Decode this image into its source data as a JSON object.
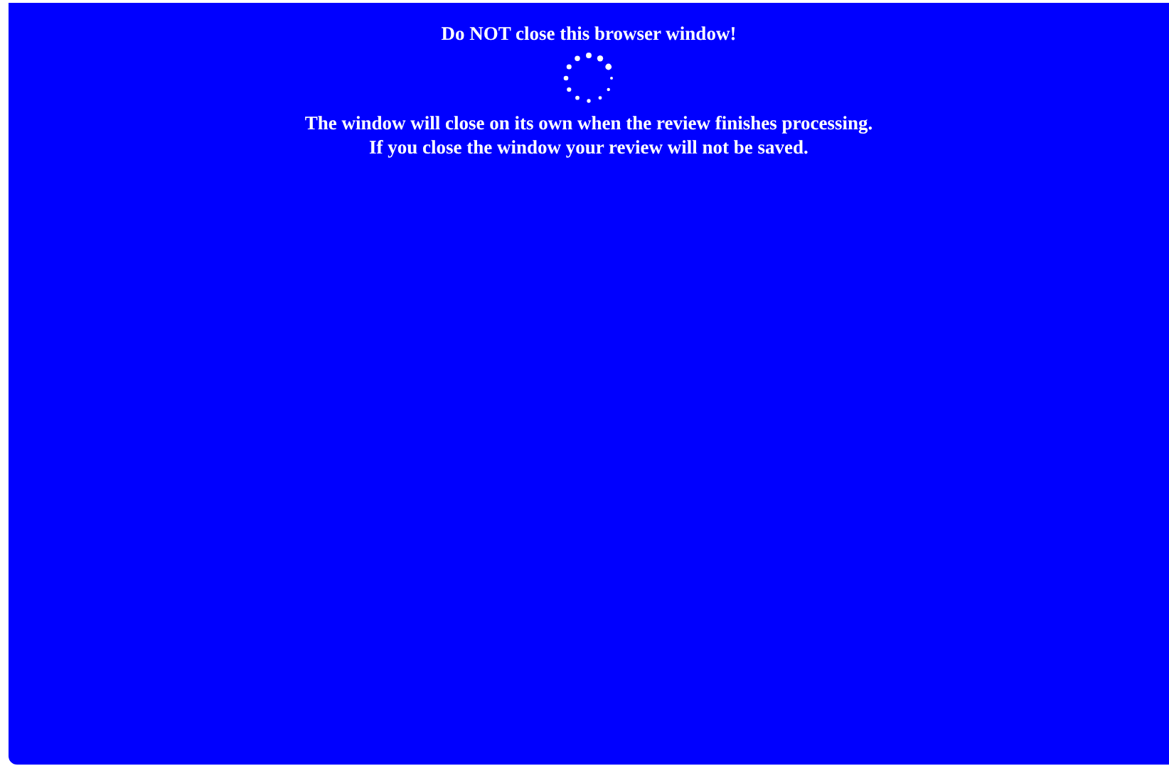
{
  "heading": "Do NOT close this browser window!",
  "messages": [
    "The window will close on its own when the review finishes processing.",
    "If you close the window your review will not be saved."
  ]
}
